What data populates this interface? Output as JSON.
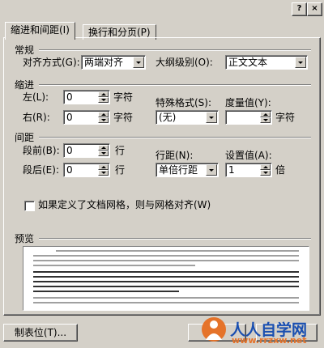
{
  "window": {
    "help_glyph": "?",
    "close_glyph": "×"
  },
  "tabs": [
    {
      "label": "缩进和间距(I)"
    },
    {
      "label": "换行和分页(P)"
    }
  ],
  "general": {
    "title": "常规",
    "align_label": "对齐方式(G):",
    "align_value": "两端对齐",
    "outline_label": "大纲级别(O):",
    "outline_value": "正文文本"
  },
  "indent": {
    "title": "缩进",
    "left_label": "左(L):",
    "left_value": "0",
    "left_unit": "字符",
    "right_label": "右(R):",
    "right_value": "0",
    "right_unit": "字符",
    "special_label": "特殊格式(S):",
    "special_value": "(无)",
    "by_label": "度量值(Y):",
    "by_value": "",
    "by_unit": "字符"
  },
  "spacing": {
    "title": "间距",
    "before_label": "段前(B):",
    "before_value": "0",
    "before_unit": "行",
    "after_label": "段后(E):",
    "after_value": "0",
    "after_unit": "行",
    "line_label": "行距(N):",
    "line_value": "单倍行距",
    "at_label": "设置值(A):",
    "at_value": "1",
    "at_unit": "倍"
  },
  "grid_checkbox": {
    "label": "如果定义了文档网格，则与网格对齐(W)",
    "checked": false
  },
  "preview": {
    "title": "预览"
  },
  "buttons": {
    "tabs_button": "制表位(T)..."
  },
  "watermark": {
    "text": "人人自学网",
    "url": "www.rrzxw.net"
  }
}
